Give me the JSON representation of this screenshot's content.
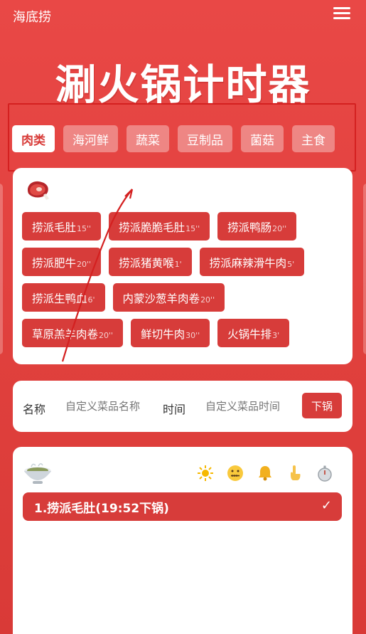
{
  "header": {
    "brand": "海底捞",
    "menu_icon": "menu-icon"
  },
  "title": "涮火锅计时器",
  "tabs": [
    {
      "label": "肉类",
      "active": true
    },
    {
      "label": "海河鲜",
      "active": false
    },
    {
      "label": "蔬菜",
      "active": false
    },
    {
      "label": "豆制品",
      "active": false
    },
    {
      "label": "菌菇",
      "active": false
    },
    {
      "label": "主食",
      "active": false
    }
  ],
  "category_icon": "steak-icon",
  "food_rows": [
    [
      {
        "name": "捞派毛肚",
        "mins": "15''"
      },
      {
        "name": "捞派脆脆毛肚",
        "mins": "15''"
      },
      {
        "name": "捞派鸭肠",
        "mins": "20''"
      }
    ],
    [
      {
        "name": "捞派肥牛",
        "mins": "20''"
      },
      {
        "name": "捞派猪黄喉",
        "mins": "1'"
      },
      {
        "name": "捞派麻辣滑牛肉",
        "mins": "5'"
      }
    ],
    [
      {
        "name": "捞派生鸭血",
        "mins": "6'"
      },
      {
        "name": "内蒙沙葱羊肉卷",
        "mins": "20''"
      }
    ],
    [
      {
        "name": "草原羔羊肉卷",
        "mins": "20''"
      },
      {
        "name": "鲜切牛肉",
        "mins": "30''"
      },
      {
        "name": "火锅牛排",
        "mins": "3'"
      }
    ]
  ],
  "custom": {
    "name_label": "名称",
    "name_placeholder": "自定义菜品名称",
    "time_label": "时间",
    "time_placeholder": "自定义菜品时间",
    "submit_label": "下锅"
  },
  "pot": {
    "pot_icon": "hotpot-bowl-icon",
    "tools": [
      "sun-icon",
      "zipper-mouth-face-icon",
      "bell-icon",
      "pointing-hand-icon",
      "stopwatch-icon"
    ],
    "timers": [
      {
        "label": "1.捞派毛肚(19:52下锅)",
        "done_icon": "check-icon"
      }
    ]
  },
  "colors": {
    "background": "#e94846",
    "button": "#d73c3a",
    "highlight_box": "#d42020"
  }
}
